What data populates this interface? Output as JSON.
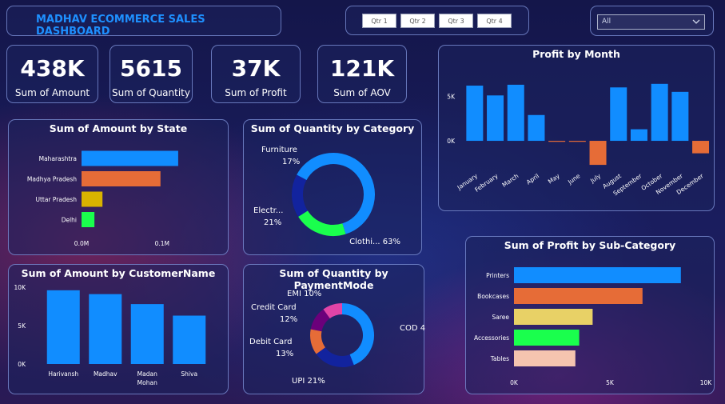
{
  "title": "MADHAV ECOMMERCE SALES DASHBOARD",
  "quarters": [
    "Qtr 1",
    "Qtr 2",
    "Qtr 3",
    "Qtr 4"
  ],
  "slicer": {
    "selected": "All"
  },
  "kpis": [
    {
      "value": "438K",
      "label": "Sum of Amount"
    },
    {
      "value": "5615",
      "label": "Sum of Quantity"
    },
    {
      "value": "37K",
      "label": "Sum of Profit"
    },
    {
      "value": "121K",
      "label": "Sum of AOV"
    }
  ],
  "colors": {
    "blue": "#118dff",
    "orange": "#e66c37",
    "yellow": "#d9b300",
    "green": "#1aff4d",
    "navy": "#12239e",
    "purple": "#6b007b",
    "magenta": "#e044a7",
    "sand": "#e8d166",
    "peach": "#f5c4af"
  },
  "chart_data": [
    {
      "id": "state",
      "type": "bar",
      "orientation": "horizontal",
      "title": "Sum of Amount by State",
      "categories": [
        "Maharashtra",
        "Madhya Pradesh",
        "Uttar Pradesh",
        "Delhi"
      ],
      "values": [
        0.12,
        0.098,
        0.026,
        0.016
      ],
      "colors": [
        "#118dff",
        "#e66c37",
        "#d9b300",
        "#1aff4d"
      ],
      "xlim": [
        0,
        0.13
      ],
      "xticks": [
        {
          "v": 0,
          "label": "0.0M"
        },
        {
          "v": 0.1,
          "label": "0.1M"
        }
      ]
    },
    {
      "id": "category",
      "type": "pie",
      "donut": true,
      "title": "Sum of Quantity by Category",
      "labels": [
        "Clothi...",
        "Electr...",
        "Furniture"
      ],
      "percent_labels": [
        "63%",
        "21%",
        "17%"
      ],
      "values": [
        63,
        21,
        17
      ],
      "colors": [
        "#118dff",
        "#1aff4d",
        "#12239e"
      ]
    },
    {
      "id": "month",
      "type": "bar",
      "title": "Profit by Month",
      "categories": [
        "January",
        "February",
        "March",
        "April",
        "May",
        "June",
        "July",
        "August",
        "September",
        "October",
        "November",
        "December"
      ],
      "values": [
        6200,
        5100,
        6300,
        2900,
        -100,
        -100,
        -2700,
        6000,
        1300,
        6400,
        5500,
        -1400
      ],
      "color_positive": "#118dff",
      "color_negative": "#e66c37",
      "ylim": [
        -3500,
        8000
      ],
      "yticks": [
        {
          "v": 0,
          "label": "0K"
        },
        {
          "v": 5000,
          "label": "5K"
        }
      ]
    },
    {
      "id": "customer",
      "type": "bar",
      "title": "Sum of Amount by CustomerName",
      "categories": [
        "Harivansh",
        "Madhav",
        "Madan Mohan",
        "Shiva"
      ],
      "values": [
        9600,
        9100,
        7800,
        6300
      ],
      "color": "#118dff",
      "ylim": [
        0,
        10000
      ],
      "yticks": [
        {
          "v": 0,
          "label": "0K"
        },
        {
          "v": 5000,
          "label": "5K"
        },
        {
          "v": 10000,
          "label": "10K"
        }
      ]
    },
    {
      "id": "payment",
      "type": "pie",
      "donut": true,
      "title": "Sum of Quantity by PaymentMode",
      "labels": [
        "COD",
        "UPI",
        "Debit Card",
        "Credit Card",
        "EMI"
      ],
      "percent_labels": [
        "44%",
        "21%",
        "13%",
        "12%",
        "10%"
      ],
      "values": [
        44,
        21,
        13,
        12,
        10
      ],
      "colors": [
        "#118dff",
        "#12239e",
        "#e66c37",
        "#6b007b",
        "#e044a7"
      ]
    },
    {
      "id": "subcat",
      "type": "bar",
      "orientation": "horizontal",
      "title": "Sum of Profit by Sub-Category",
      "categories": [
        "Printers",
        "Bookcases",
        "Saree",
        "Accessories",
        "Tables"
      ],
      "values": [
        8700,
        6700,
        4100,
        3400,
        3200
      ],
      "colors": [
        "#118dff",
        "#e66c37",
        "#e8d166",
        "#1aff4d",
        "#f5c4af"
      ],
      "xlim": [
        0,
        10000
      ],
      "xticks": [
        {
          "v": 0,
          "label": "0K"
        },
        {
          "v": 5000,
          "label": "5K"
        },
        {
          "v": 10000,
          "label": "10K"
        }
      ]
    }
  ]
}
